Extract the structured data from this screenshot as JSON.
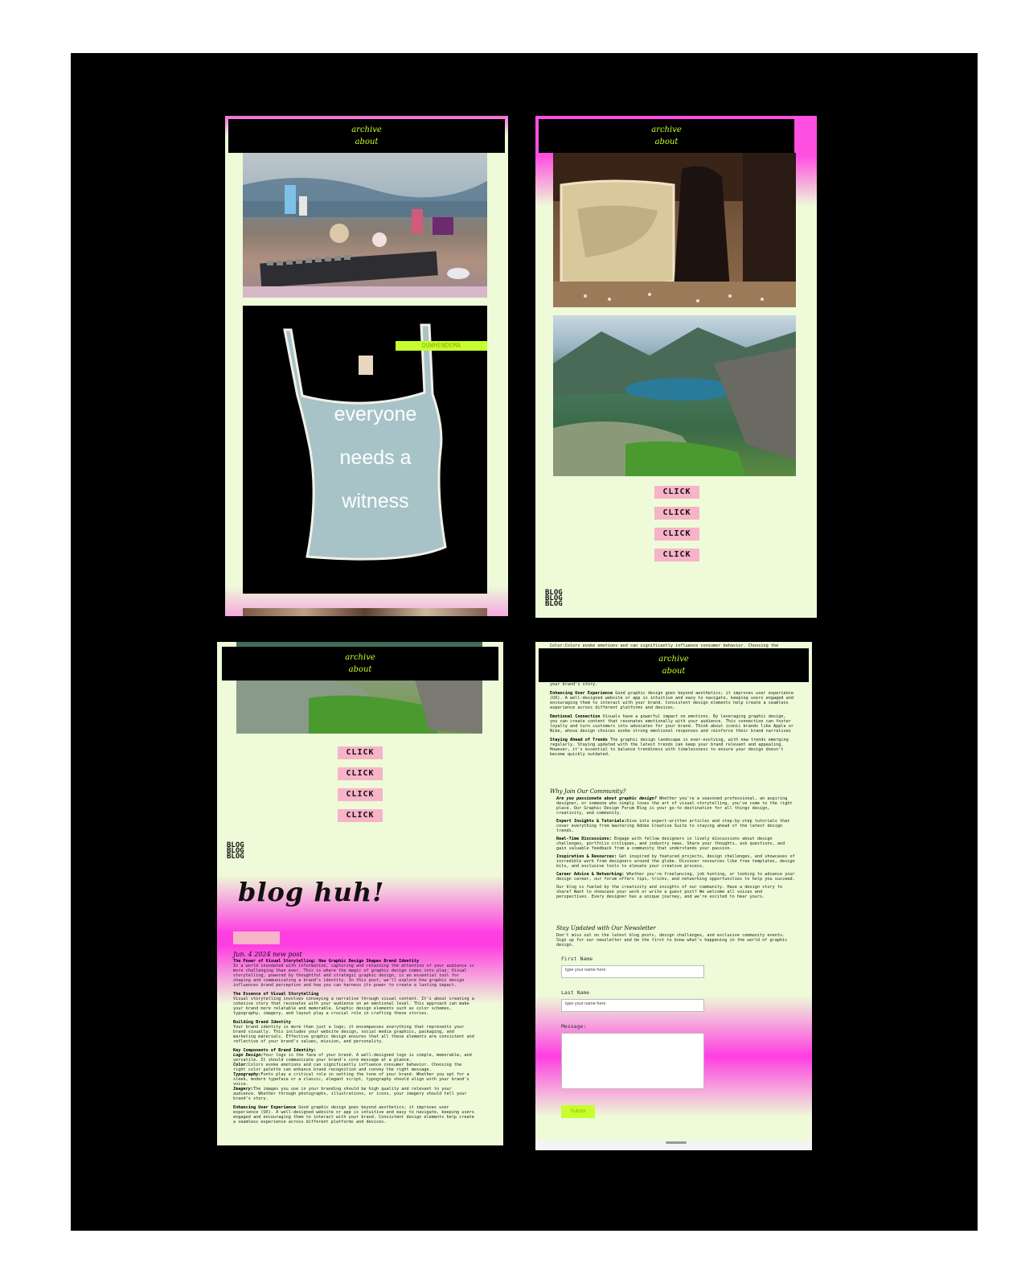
{
  "nav": {
    "archive": "archive",
    "about": "about"
  },
  "panel1": {
    "shirt_text": [
      "everyone",
      "needs a",
      "witness"
    ],
    "tag_label": "DUWHENDEMA"
  },
  "panel2": {
    "click_buttons": [
      "CLICK",
      "CLICK",
      "CLICK",
      "CLICK"
    ],
    "blog_stack": [
      "BLOG",
      "BLOG",
      "BLOG"
    ]
  },
  "panel3": {
    "click_buttons": [
      "CLICK",
      "CLICK",
      "CLICK",
      "CLICK"
    ],
    "blog_stack": [
      "BLOG",
      "BLOG",
      "BLOG"
    ],
    "heading": "blog huh!",
    "date_line": "Jun. 4 2024 new post",
    "post_title": "The Power of Visual Storytelling: How Graphic Design Shapes Brand Identity",
    "intro": "In a world inundated with information, capturing and retaining the attention of your audience is more challenging than ever. This is where the magic of graphic design comes into play. Visual storytelling, powered by thoughtful and strategic graphic design, is an essential tool for shaping and communicating a brand's identity. In this post, we'll explore how graphic design influences brand perception and how you can harness its power to create a lasting impact.",
    "essence_title": "The Essence of Visual Storytelling",
    "essence": "Visual storytelling involves conveying a narrative through visual content. It's about creating a cohesive story that resonates with your audience on an emotional level. This approach can make your brand more relatable and memorable. Graphic design elements such as color schemes, typography, imagery, and layout play a crucial role in crafting these stories.",
    "building_title": "Building Brand Identity",
    "building": "Your brand identity is more than just a logo; it encompasses everything that represents your brand visually. This includes your website design, social media graphics, packaging, and marketing materials. Effective graphic design ensures that all these elements are consistent and reflective of your brand's values, mission, and personality.",
    "components_title": "Key Components of Brand Identity:",
    "logo_label": "Logo Design:",
    "logo": "Your logo is the face of your brand. A well-designed logo is simple, memorable, and versatile. It should communicate your brand's core message at a glance.",
    "color_label": "Color:",
    "color": "Colors evoke emotions and can significantly influence consumer behavior. Choosing the right color palette can enhance brand recognition and convey the right message.",
    "typo_label": "Typography:",
    "typo": "Fonts play a critical role in setting the tone of your brand. Whether you opt for a sleek, modern typeface or a classic, elegant script, typography should align with your brand's voice.",
    "imagery_label": "Imagery:",
    "imagery": "The images you use in your branding should be high quality and relevant to your audience. Whether through photographs, illustrations, or icons, your imagery should tell your brand's story.",
    "ux_label": "Enhancing User Experience",
    "ux": "Good graphic design goes beyond aesthetics; it improves user experience (UX). A well-designed website or app is intuitive and easy to navigate, keeping users engaged and encouraging them to interact with your brand. Consistent design elements help create a seamless experience across different platforms and devices."
  },
  "panel4": {
    "top_color": "Color:Colors evoke emotions and can significantly influence consumer behavior. Choosing the",
    "top_story": "your brand's story.",
    "ux_label": "Enhancing User Experience",
    "ux": "Good graphic design goes beyond aesthetics; it improves user experience (UX). A well-designed website or app is intuitive and easy to navigate, keeping users engaged and encouraging them to interact with your brand. Consistent design elements help create a seamless experience across different platforms and devices.",
    "emo_label": "Emotional Connection",
    "emo": "Visuals have a powerful impact on emotions. By leveraging graphic design, you can create content that resonates emotionally with your audience. This connection can foster loyalty and turn customers into advocates for your brand. Think about iconic brands like Apple or Nike, whose design choices evoke strong emotional responses and reinforce their brand narratives",
    "ahead_label": "Staying Ahead of Trends",
    "ahead": "The graphic design landscape is ever-evolving, with new trends emerging regularly. Staying updated with the latest trends can keep your brand relevant and appealing. However, it's essential to balance trendiness with timelessness to ensure your design doesn't become quickly outdated.",
    "why_title": "Why Join Our Community?",
    "passion_label": "Are you passionate about graphic design?",
    "passion": "Whether you're a seasoned professional, an aspiring designer, or someone who simply loves the art of visual storytelling, you've come to the right place. Our Graphic Design Forum Blog is your go-to destination for all things design, creativity, and community.",
    "expert_label": "Expert Insights & Tutorials:",
    "expert": "Dive into expert-written articles and step-by-step tutorials that cover everything from mastering Adobe Creative Suite to staying ahead of the latest design trends.",
    "rt_label": "Real-Time Discussions:",
    "rt": "Engage with fellow designers in lively discussions about design challenges, portfolio critiques, and industry news. Share your thoughts, ask questions, and gain valuable feedback from a community that understands your passion.",
    "insp_label": "Inspiration & Resources:",
    "insp": "Get inspired by featured projects, design challenges, and showcases of incredible work from designers around the globe. Discover resources like free templates, design kits, and exclusive tools to elevate your creative process.",
    "career_label": "Career Advice & Networking:",
    "career": "Whether you're freelancing, job hunting, or looking to advance your design career, our forum offers tips, tricks, and networking opportunities to help you succeed.",
    "fueled": "Our blog is fueled by the creativity and insights of our community. Have a design story to share? Want to showcase your work or write a guest post? We welcome all voices and perspectives. Every designer has a unique journey, and we're excited to hear yours.",
    "newsletter_title": "Stay Updated with Our Newsletter",
    "newsletter": "Don't miss out on the latest blog posts, design challenges, and exclusive community events. Sign up for our newsletter and be the first to know what's happening in the world of graphic design.",
    "first_label": "First Name",
    "first_placeholder": "type your name here",
    "last_label": "Last Name",
    "last_placeholder": "type your name here",
    "message_label": "Message:",
    "submit": "Submit"
  },
  "colors": {
    "accent_lime": "#c6ff2c",
    "pink": "#ff3ee2",
    "bg_mint": "#eefad8",
    "button_pink": "#f7b3c8"
  }
}
